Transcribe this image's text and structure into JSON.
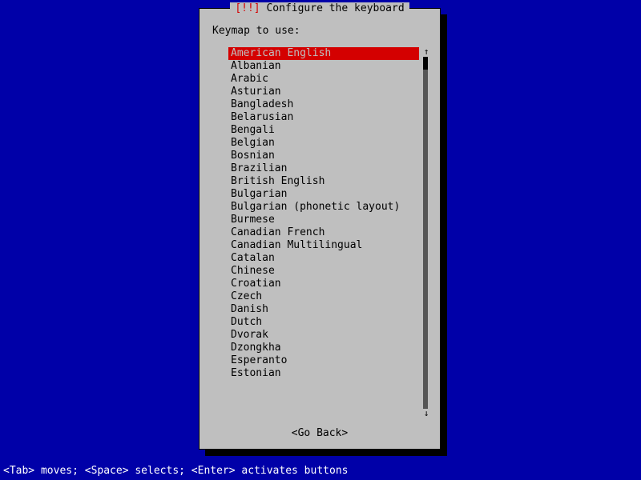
{
  "dialog": {
    "title_marker": "[!!]",
    "title_text": "Configure the keyboard",
    "prompt": "Keymap to use:",
    "go_back": "<Go Back>"
  },
  "keymaps": [
    "American English",
    "Albanian",
    "Arabic",
    "Asturian",
    "Bangladesh",
    "Belarusian",
    "Bengali",
    "Belgian",
    "Bosnian",
    "Brazilian",
    "British English",
    "Bulgarian",
    "Bulgarian (phonetic layout)",
    "Burmese",
    "Canadian French",
    "Canadian Multilingual",
    "Catalan",
    "Chinese",
    "Croatian",
    "Czech",
    "Danish",
    "Dutch",
    "Dvorak",
    "Dzongkha",
    "Esperanto",
    "Estonian"
  ],
  "selected_index": 0,
  "scroll": {
    "up_arrow": "↑",
    "down_arrow": "↓"
  },
  "help": "<Tab> moves; <Space> selects; <Enter> activates buttons"
}
